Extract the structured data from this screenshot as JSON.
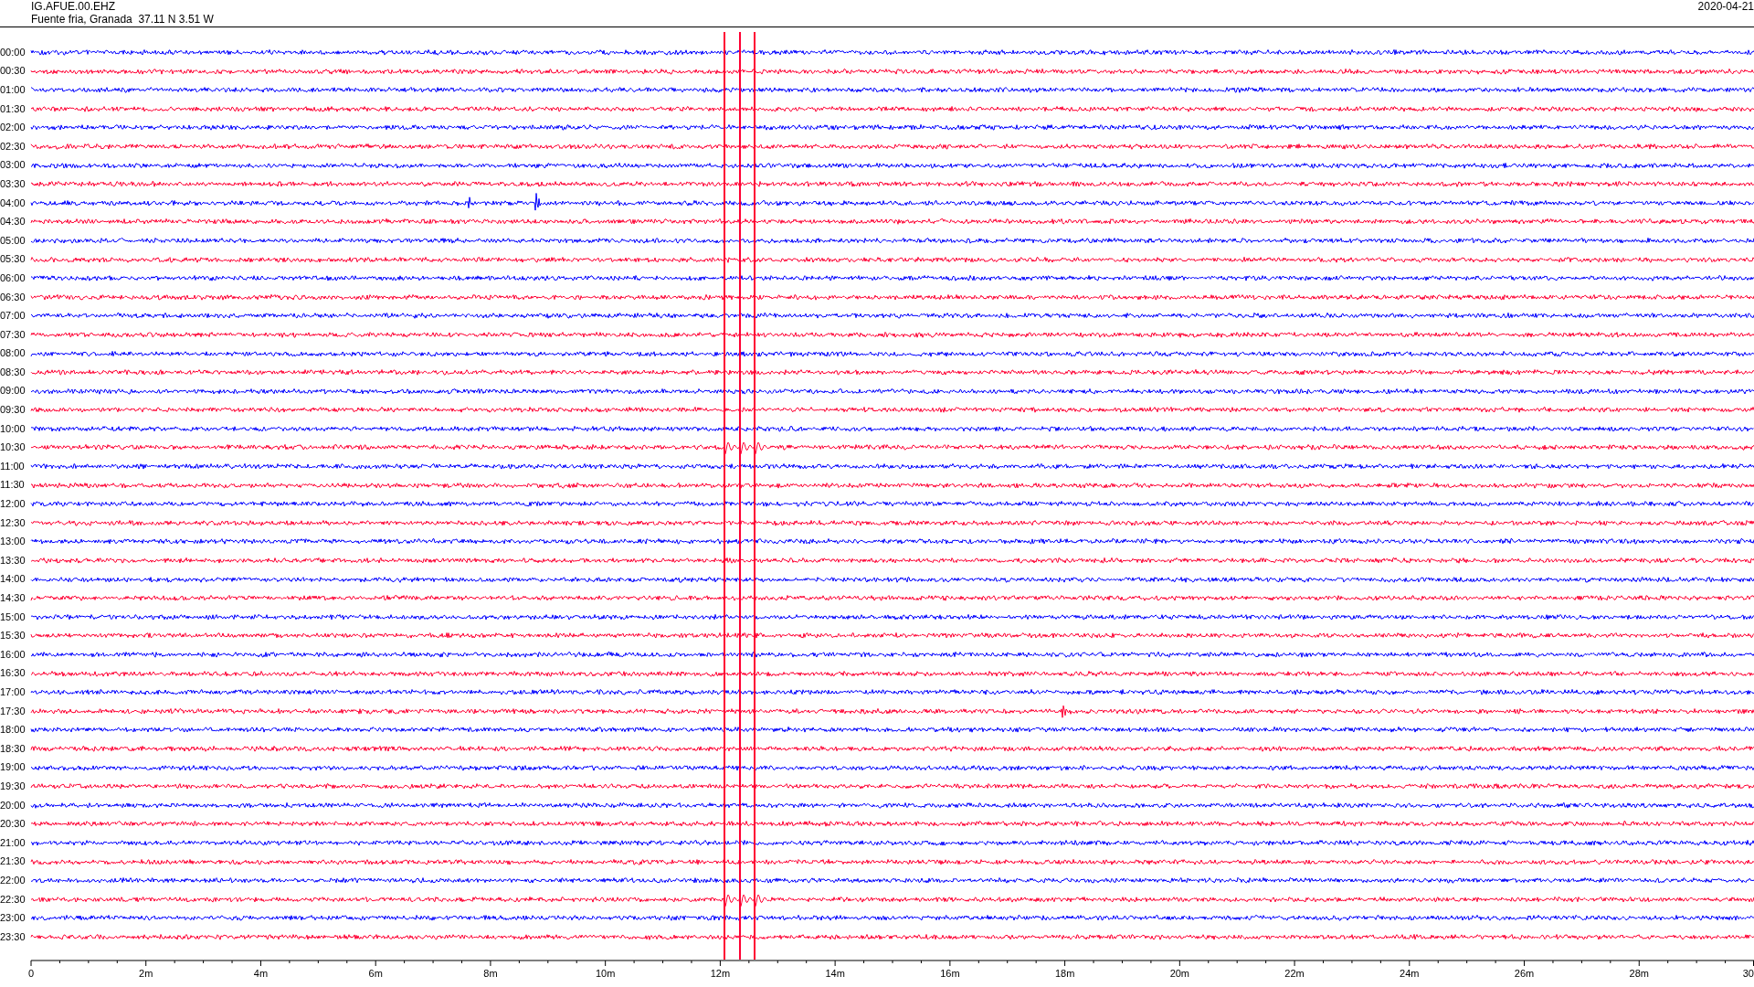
{
  "header": {
    "station": "IG.AFUE.00.EHZ",
    "location": "Fuente fria, Granada  37.11 N 3.51 W",
    "date": "2020-04-21"
  },
  "rows": [
    {
      "label": "00:00",
      "color": "#0000ff"
    },
    {
      "label": "00:30",
      "color": "#ff0033"
    },
    {
      "label": "01:00",
      "color": "#0000ff"
    },
    {
      "label": "01:30",
      "color": "#ff0033"
    },
    {
      "label": "02:00",
      "color": "#0000ff"
    },
    {
      "label": "02:30",
      "color": "#ff0033"
    },
    {
      "label": "03:00",
      "color": "#0000ff"
    },
    {
      "label": "03:30",
      "color": "#ff0033"
    },
    {
      "label": "04:00",
      "color": "#0000ff"
    },
    {
      "label": "04:30",
      "color": "#ff0033"
    },
    {
      "label": "05:00",
      "color": "#0000ff"
    },
    {
      "label": "05:30",
      "color": "#ff0033"
    },
    {
      "label": "06:00",
      "color": "#0000ff"
    },
    {
      "label": "06:30",
      "color": "#ff0033"
    },
    {
      "label": "07:00",
      "color": "#0000ff"
    },
    {
      "label": "07:30",
      "color": "#ff0033"
    },
    {
      "label": "08:00",
      "color": "#0000ff"
    },
    {
      "label": "08:30",
      "color": "#ff0033"
    },
    {
      "label": "09:00",
      "color": "#0000ff"
    },
    {
      "label": "09:30",
      "color": "#ff0033"
    },
    {
      "label": "10:00",
      "color": "#0000ff"
    },
    {
      "label": "10:30",
      "color": "#ff0033"
    },
    {
      "label": "11:00",
      "color": "#0000ff"
    },
    {
      "label": "11:30",
      "color": "#ff0033"
    },
    {
      "label": "12:00",
      "color": "#0000ff"
    },
    {
      "label": "12:30",
      "color": "#ff0033"
    },
    {
      "label": "13:00",
      "color": "#0000ff"
    },
    {
      "label": "13:30",
      "color": "#ff0033"
    },
    {
      "label": "14:00",
      "color": "#0000ff"
    },
    {
      "label": "14:30",
      "color": "#ff0033"
    },
    {
      "label": "15:00",
      "color": "#0000ff"
    },
    {
      "label": "15:30",
      "color": "#ff0033"
    },
    {
      "label": "16:00",
      "color": "#0000ff"
    },
    {
      "label": "16:30",
      "color": "#ff0033"
    },
    {
      "label": "17:00",
      "color": "#0000ff"
    },
    {
      "label": "17:30",
      "color": "#ff0033"
    },
    {
      "label": "18:00",
      "color": "#0000ff"
    },
    {
      "label": "18:30",
      "color": "#ff0033"
    },
    {
      "label": "19:00",
      "color": "#0000ff"
    },
    {
      "label": "19:30",
      "color": "#ff0033"
    },
    {
      "label": "20:00",
      "color": "#0000ff"
    },
    {
      "label": "20:30",
      "color": "#ff0033"
    },
    {
      "label": "21:00",
      "color": "#0000ff"
    },
    {
      "label": "21:30",
      "color": "#ff0033"
    },
    {
      "label": "22:00",
      "color": "#0000ff"
    },
    {
      "label": "22:30",
      "color": "#ff0033"
    },
    {
      "label": "23:00",
      "color": "#0000ff"
    },
    {
      "label": "23:30",
      "color": "#ff0033"
    }
  ],
  "time_axis": {
    "ticks": [
      "0",
      "2m",
      "4m",
      "6m",
      "8m",
      "10m",
      "12m",
      "14m",
      "16m",
      "18m",
      "20m",
      "22m",
      "24m",
      "26m",
      "28m",
      "30"
    ]
  }
}
